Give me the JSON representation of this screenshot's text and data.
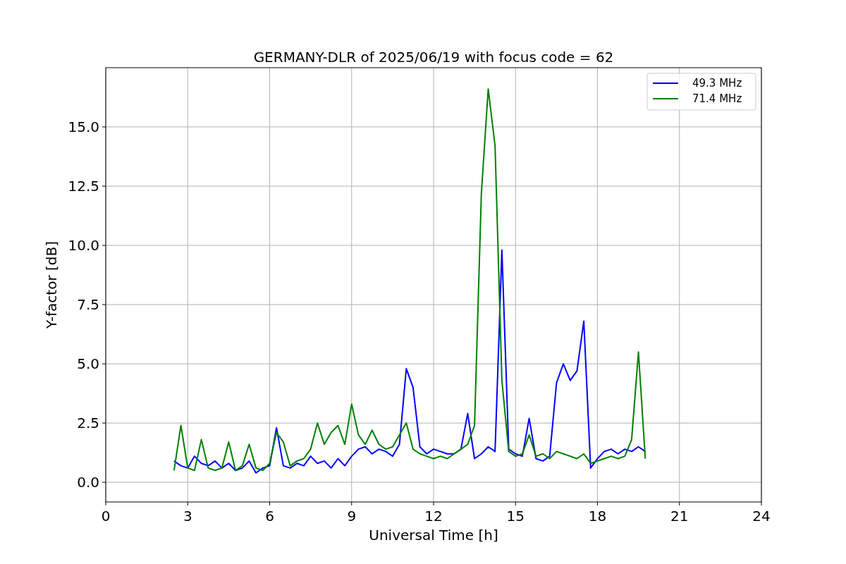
{
  "chart_data": {
    "type": "line",
    "title": "GERMANY-DLR of 2025/06/19 with focus code = 62",
    "xlabel": "Universal Time [h]",
    "ylabel": "Y-factor [dB]",
    "x": [
      2.5,
      2.75,
      3,
      3.25,
      3.5,
      3.75,
      4,
      4.25,
      4.5,
      4.75,
      5,
      5.25,
      5.5,
      5.75,
      6,
      6.25,
      6.5,
      6.75,
      7,
      7.25,
      7.5,
      7.75,
      8,
      8.25,
      8.5,
      8.75,
      9,
      9.25,
      9.5,
      9.75,
      10,
      10.25,
      10.5,
      10.75,
      11,
      11.25,
      11.5,
      11.75,
      12,
      12.25,
      12.5,
      12.75,
      13,
      13.25,
      13.5,
      13.75,
      14,
      14.25,
      14.5,
      14.75,
      15,
      15.25,
      15.5,
      15.75,
      16,
      16.25,
      16.5,
      16.75,
      17,
      17.25,
      17.5,
      17.75,
      18,
      18.25,
      18.5,
      18.75,
      19,
      19.25,
      19.5,
      19.75
    ],
    "series": [
      {
        "name": "49.3 MHz",
        "color": "#0000ff",
        "values": [
          0.9,
          0.7,
          0.6,
          1.1,
          0.8,
          0.7,
          0.9,
          0.6,
          0.8,
          0.5,
          0.6,
          0.9,
          0.4,
          0.6,
          0.7,
          2.3,
          0.7,
          0.6,
          0.8,
          0.7,
          1.1,
          0.8,
          0.9,
          0.6,
          1.0,
          0.7,
          1.1,
          1.4,
          1.5,
          1.2,
          1.4,
          1.3,
          1.1,
          1.6,
          4.8,
          4.0,
          1.5,
          1.2,
          1.4,
          1.3,
          1.2,
          1.2,
          1.4,
          2.9,
          1.0,
          1.2,
          1.5,
          1.3,
          9.8,
          1.4,
          1.2,
          1.1,
          2.7,
          1.0,
          0.9,
          1.1,
          4.2,
          5.0,
          4.3,
          4.7,
          6.8,
          0.6,
          1.0,
          1.3,
          1.4,
          1.2,
          1.4,
          1.3,
          1.5,
          1.3
        ]
      },
      {
        "name": "71.4 MHz",
        "color": "#008000",
        "values": [
          0.5,
          2.4,
          0.6,
          0.5,
          1.8,
          0.6,
          0.5,
          0.6,
          1.7,
          0.5,
          0.7,
          1.6,
          0.6,
          0.5,
          0.8,
          2.1,
          1.7,
          0.7,
          0.9,
          1.0,
          1.4,
          2.5,
          1.6,
          2.1,
          2.4,
          1.6,
          3.3,
          2.0,
          1.6,
          2.2,
          1.6,
          1.4,
          1.5,
          2.0,
          2.5,
          1.4,
          1.2,
          1.1,
          1.0,
          1.1,
          1.0,
          1.2,
          1.4,
          1.6,
          2.4,
          12.2,
          16.6,
          14.2,
          4.3,
          1.3,
          1.1,
          1.2,
          2.0,
          1.1,
          1.2,
          1.0,
          1.3,
          1.2,
          1.1,
          1.0,
          1.2,
          0.8,
          0.9,
          1.0,
          1.1,
          1.0,
          1.1,
          1.8,
          5.5,
          1.0
        ]
      }
    ],
    "grid": true,
    "legend": true,
    "xlim": [
      0,
      24
    ],
    "ylim": [
      -0.83,
      17.5
    ],
    "xticks": [
      0,
      3,
      6,
      9,
      12,
      15,
      18,
      21,
      24
    ],
    "yticks": [
      {
        "value": 0,
        "label": "0.0"
      },
      {
        "value": 2.5,
        "label": "2.5"
      },
      {
        "value": 5,
        "label": "5.0"
      },
      {
        "value": 7.5,
        "label": "7.5"
      },
      {
        "value": 10,
        "label": "10.0"
      },
      {
        "value": 12.5,
        "label": "12.5"
      },
      {
        "value": 15,
        "label": "15.0"
      }
    ]
  }
}
